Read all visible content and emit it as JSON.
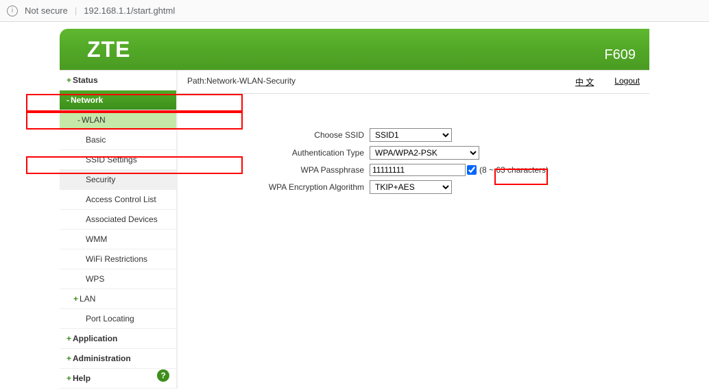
{
  "browser": {
    "security_text": "Not secure",
    "url": "192.168.1.1/start.ghtml"
  },
  "header": {
    "logo": "ZTE",
    "model": "F609"
  },
  "sidebar": {
    "status": "Status",
    "network": "Network",
    "wlan": "WLAN",
    "basic": "Basic",
    "ssid_settings": "SSID Settings",
    "security": "Security",
    "access_control": "Access Control List",
    "associated": "Associated Devices",
    "wmm": "WMM",
    "wifi_restrictions": "WiFi Restrictions",
    "wps": "WPS",
    "lan": "LAN",
    "port_locating": "Port Locating",
    "application": "Application",
    "administration": "Administration",
    "help": "Help"
  },
  "path": {
    "label": "Path:Network-WLAN-Security",
    "lang": "中 文",
    "logout": "Logout"
  },
  "form": {
    "ssid_label": "Choose SSID",
    "ssid_value": "SSID1",
    "auth_label": "Authentication Type",
    "auth_value": "WPA/WPA2-PSK",
    "pass_label": "WPA Passphrase",
    "pass_value": "11111111",
    "pass_hint": "(8 ~ 63 characters)",
    "enc_label": "WPA Encryption Algorithm",
    "enc_value": "TKIP+AES"
  }
}
